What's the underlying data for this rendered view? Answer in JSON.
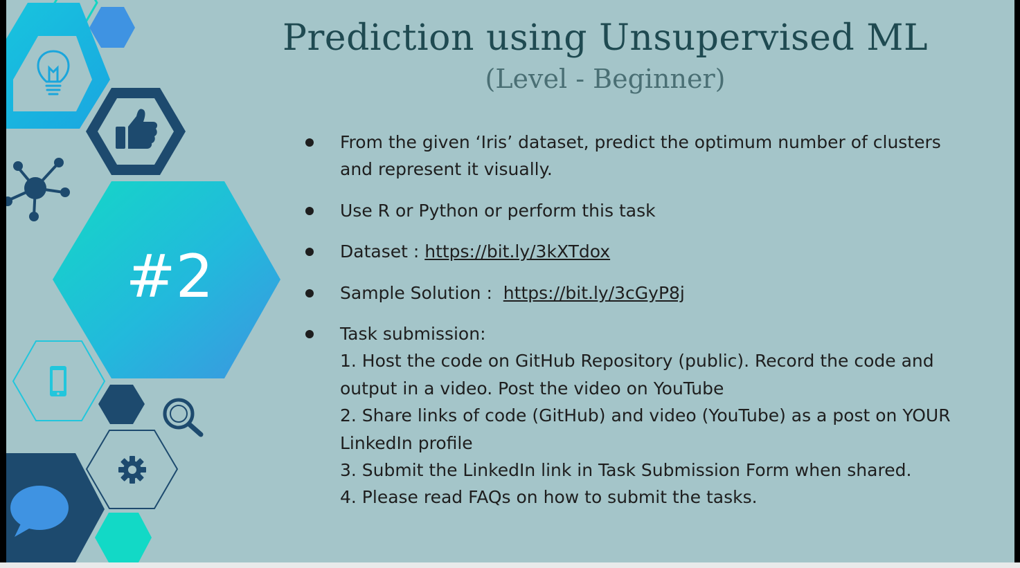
{
  "slide": {
    "title": "Prediction using Unsupervised ML",
    "subtitle": "(Level - Beginner)",
    "badge": "#2"
  },
  "bullets": {
    "item1": "From the given ‘Iris’ dataset, predict the optimum number of  clusters and represent it visually.",
    "item2": "Use R or Python or perform this task",
    "dataset_label": "Dataset : ",
    "dataset_link": "https://bit.ly/3kXTdox",
    "solution_label": "Sample Solution :  ",
    "solution_link": "https://bit.ly/3cGyP8j",
    "submission_label": "Task submission:",
    "steps": [
      "1. Host the code on GitHub Repository (public). Record the code and output in a video. Post the video on YouTube",
      "2. Share links of code (GitHub) and video (YouTube) as a post on YOUR LinkedIn profile",
      "3. Submit the LinkedIn link in Task Submission Form when shared.",
      "4. Please read FAQs on how to submit the tasks."
    ]
  },
  "colors": {
    "background": "#a4c5c9",
    "title": "#1f4a51",
    "navy": "#1d4a6e",
    "cyan": "#22c6dc",
    "teal": "#12d9c6",
    "blue": "#3f93e2"
  },
  "icons": [
    "lightbulb-icon",
    "thumbs-up-icon",
    "network-icon",
    "smartphone-icon",
    "magnifier-icon",
    "gear-icon",
    "chat-bubble-icon"
  ]
}
